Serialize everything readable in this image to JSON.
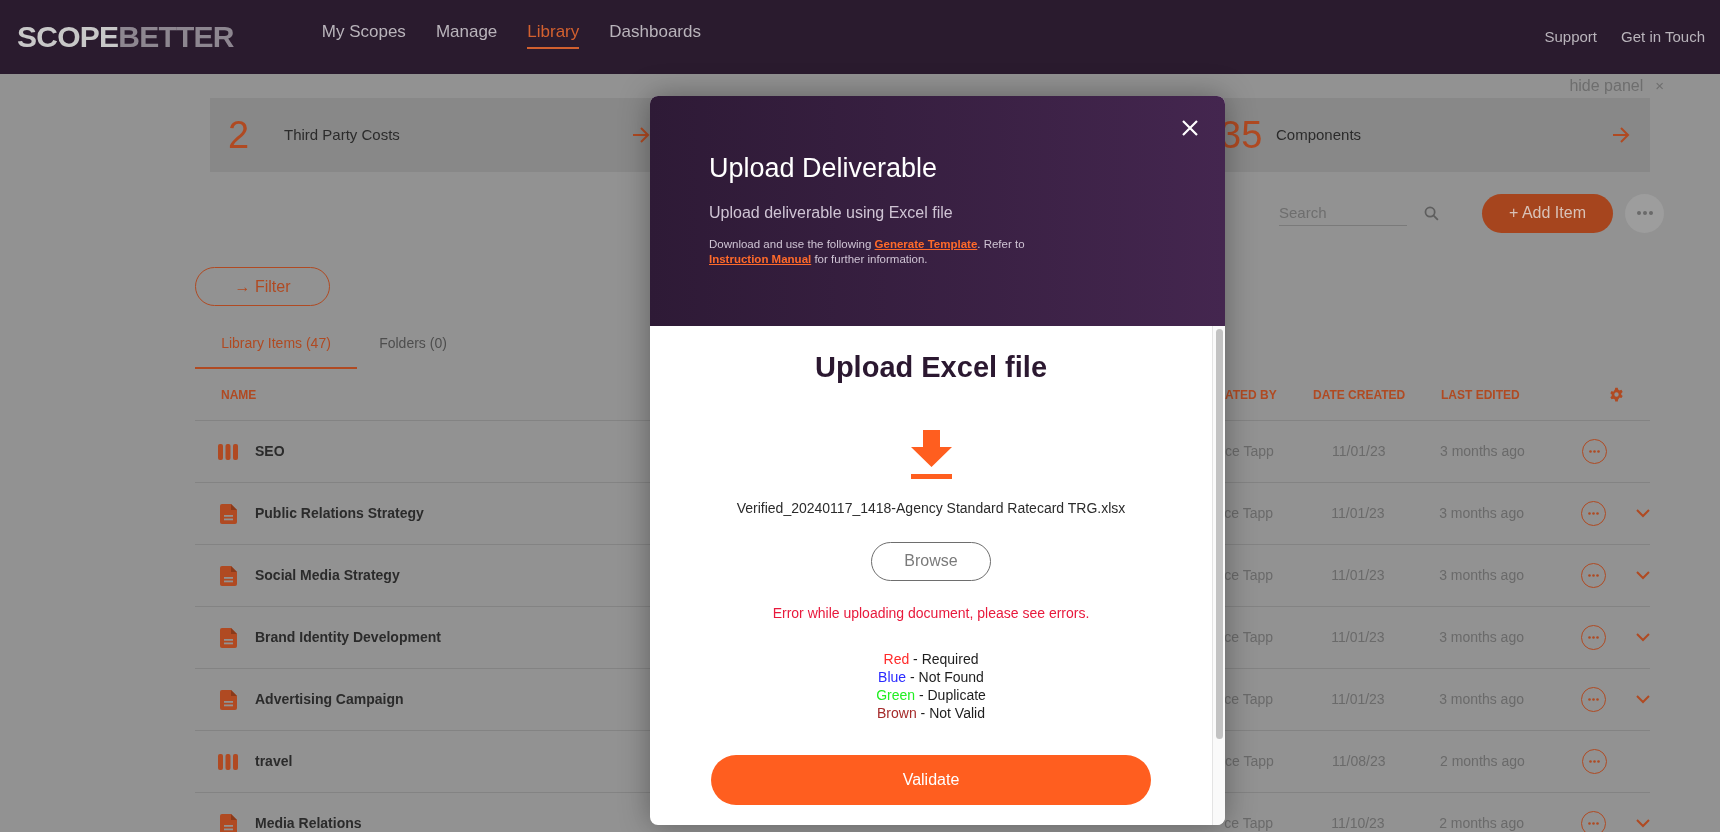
{
  "header": {
    "logo_left": "SCOPE",
    "logo_right": "BETTER",
    "nav": [
      {
        "label": "My Scopes",
        "selected": false
      },
      {
        "label": "Manage",
        "selected": false
      },
      {
        "label": "Library",
        "selected": true
      },
      {
        "label": "Dashboards",
        "selected": false
      }
    ],
    "links": [
      "Support",
      "Get in Touch"
    ]
  },
  "hide_panel": {
    "label": "hide panel",
    "close": "×"
  },
  "stats": [
    {
      "count": "2",
      "label": "Third Party Costs"
    },
    {
      "count": "35",
      "label": "Components"
    }
  ],
  "search": {
    "placeholder": "Search"
  },
  "add_button": "+ Add Item",
  "filter_button": "→ Filter",
  "tabs": [
    {
      "label": "Library Items (47)",
      "selected": true
    },
    {
      "label": "Folders (0)",
      "selected": false
    }
  ],
  "table": {
    "columns": [
      "NAME",
      "ATED BY",
      "DATE CREATED",
      "LAST EDITED"
    ],
    "rows": [
      {
        "kind": "folder",
        "name": "SEO",
        "created_by": "ce Tapp",
        "date_created": "11/01/23",
        "last_edited": "3 months ago",
        "expandable": false
      },
      {
        "kind": "document",
        "name": "Public Relations Strategy",
        "created_by": "ce Tapp",
        "date_created": "11/01/23",
        "last_edited": "3 months ago",
        "expandable": true
      },
      {
        "kind": "document",
        "name": "Social Media Strategy",
        "created_by": "ce Tapp",
        "date_created": "11/01/23",
        "last_edited": "3 months ago",
        "expandable": true
      },
      {
        "kind": "document",
        "name": "Brand Identity Development",
        "created_by": "ce Tapp",
        "date_created": "11/01/23",
        "last_edited": "3 months ago",
        "expandable": true
      },
      {
        "kind": "document",
        "name": "Advertising Campaign",
        "created_by": "ce Tapp",
        "date_created": "11/01/23",
        "last_edited": "3 months ago",
        "expandable": true
      },
      {
        "kind": "folder",
        "name": "travel",
        "created_by": "ce Tapp",
        "date_created": "11/08/23",
        "last_edited": "2 months ago",
        "expandable": false
      },
      {
        "kind": "document",
        "name": "Media Relations",
        "created_by": "ce Tapp",
        "date_created": "11/10/23",
        "last_edited": "2 months ago",
        "expandable": true
      }
    ]
  },
  "modal": {
    "title": "Upload Deliverable",
    "subtitle": "Upload deliverable using Excel file",
    "help": {
      "before": "Download and use the following ",
      "link_1": "Generate Template",
      "middle": ". Refer to ",
      "link_2": "Instruction Manual",
      "after": " for further information."
    },
    "heading": "Upload Excel file",
    "file_name": "Verified_20240117_1418-Agency Standard Ratecard TRG.xlsx",
    "browse_button": "Browse",
    "error": "Error while uploading document, please see errors.",
    "legend": [
      {
        "name": "Red",
        "color": "#ff2a2a",
        "meaning": "- Required"
      },
      {
        "name": "Blue",
        "color": "#2a2aff",
        "meaning": "- Not Found"
      },
      {
        "name": "Green",
        "color": "#22ee22",
        "meaning": "- Duplicate"
      },
      {
        "name": "Brown",
        "color": "#a52a2a",
        "meaning": "- Not Valid"
      }
    ],
    "validate_button": "Validate"
  }
}
